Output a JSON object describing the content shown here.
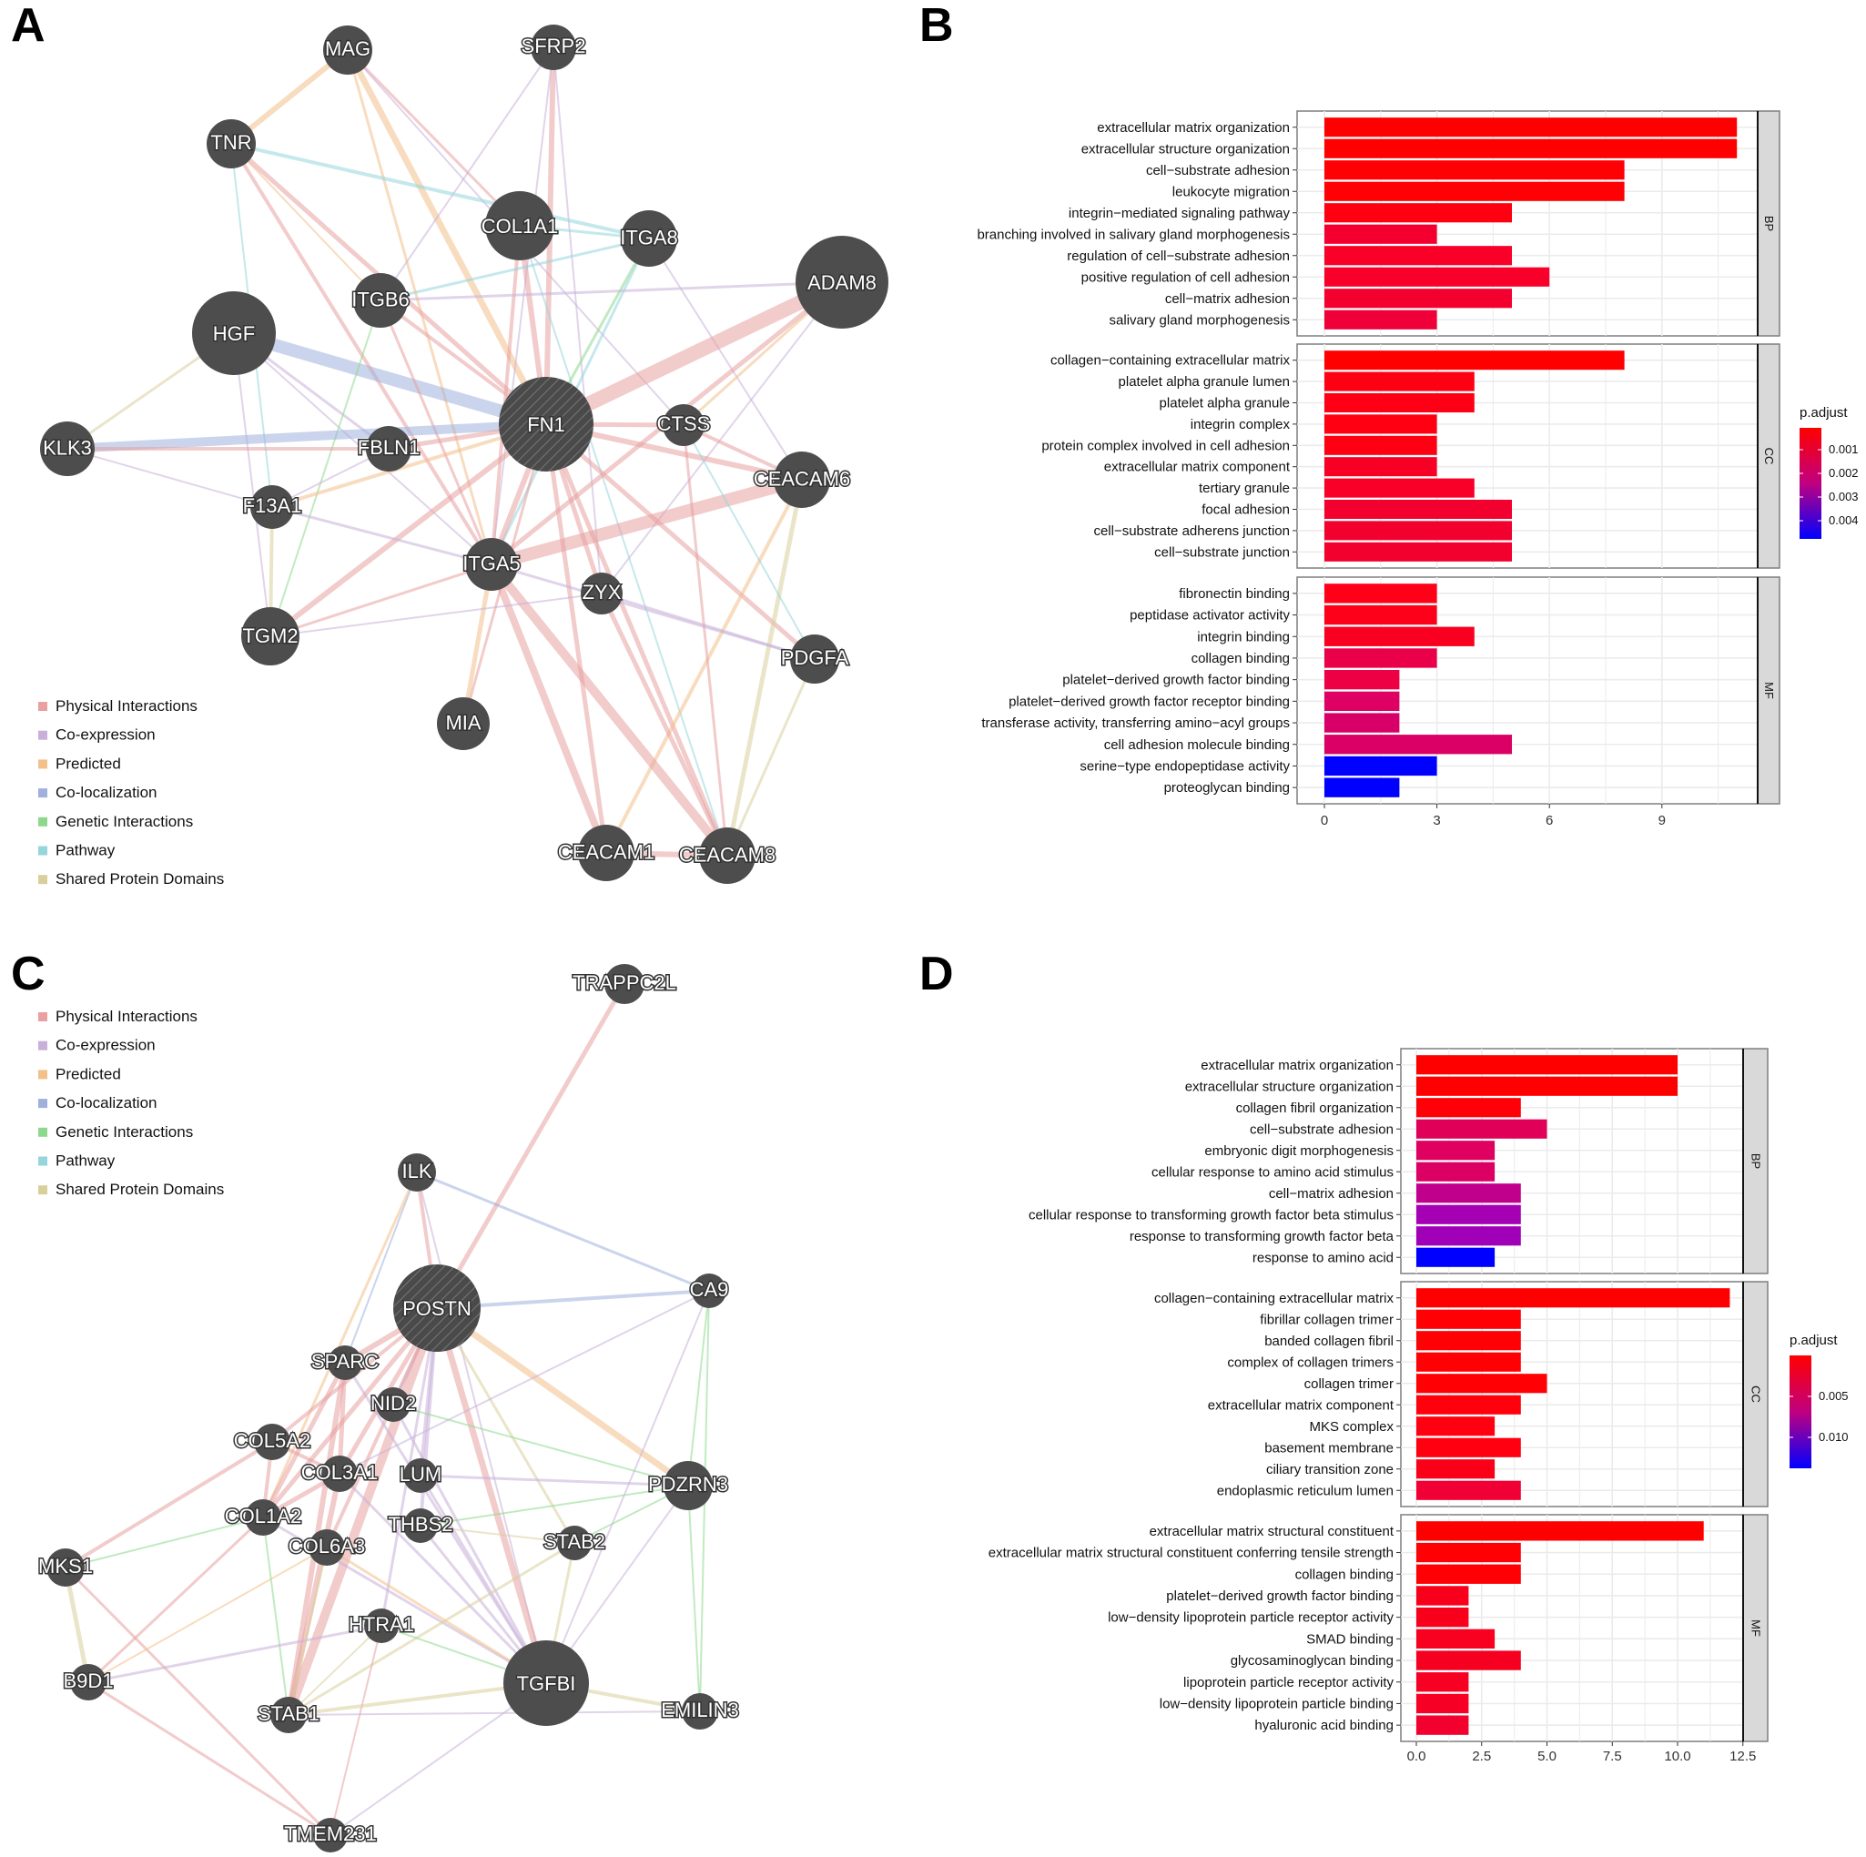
{
  "panels": {
    "A": "A",
    "B": "B",
    "C": "C",
    "D": "D"
  },
  "network_legend": [
    {
      "label": "Physical Interactions",
      "color": "#e8a0a0"
    },
    {
      "label": "Co-expression",
      "color": "#c9b0d8"
    },
    {
      "label": "Predicted",
      "color": "#f2c08a"
    },
    {
      "label": "Co-localization",
      "color": "#9fb0dc"
    },
    {
      "label": "Genetic Interactions",
      "color": "#8ed88e"
    },
    {
      "label": "Pathway",
      "color": "#95d6dc"
    },
    {
      "label": "Shared Protein Domains",
      "color": "#d8cf9c"
    }
  ],
  "network_A": {
    "query_gene": "FN1",
    "nodes": [
      {
        "id": "MAG"
      },
      {
        "id": "SFRP2"
      },
      {
        "id": "TNR"
      },
      {
        "id": "COL1A1"
      },
      {
        "id": "ITGA8"
      },
      {
        "id": "ADAM8"
      },
      {
        "id": "ITGB6"
      },
      {
        "id": "HGF"
      },
      {
        "id": "FN1"
      },
      {
        "id": "CTSS"
      },
      {
        "id": "KLK3"
      },
      {
        "id": "FBLN1"
      },
      {
        "id": "CEACAM6"
      },
      {
        "id": "F13A1"
      },
      {
        "id": "ITGA5"
      },
      {
        "id": "ZYX"
      },
      {
        "id": "TGM2"
      },
      {
        "id": "PDGFA"
      },
      {
        "id": "MIA"
      },
      {
        "id": "CEACAM1"
      },
      {
        "id": "CEACAM8"
      }
    ]
  },
  "network_C": {
    "query_gene": "POSTN",
    "nodes": [
      {
        "id": "TRAPPC2L"
      },
      {
        "id": "ILK"
      },
      {
        "id": "POSTN"
      },
      {
        "id": "CA9"
      },
      {
        "id": "SPARC"
      },
      {
        "id": "NID2"
      },
      {
        "id": "COL5A2"
      },
      {
        "id": "COL3A1"
      },
      {
        "id": "LUM"
      },
      {
        "id": "PDZRN3"
      },
      {
        "id": "COL1A2"
      },
      {
        "id": "THBS2"
      },
      {
        "id": "STAB2"
      },
      {
        "id": "MKS1"
      },
      {
        "id": "COL6A3"
      },
      {
        "id": "HTRA1"
      },
      {
        "id": "B9D1"
      },
      {
        "id": "TGFBI"
      },
      {
        "id": "STAB1"
      },
      {
        "id": "EMILIN3"
      },
      {
        "id": "TMEM231"
      }
    ]
  },
  "chart_data": [
    {
      "type": "bar",
      "orientation": "horizontal",
      "panel": "B",
      "xlabel": "",
      "ylabel": "",
      "xlim": [
        0,
        11.6
      ],
      "xticks": [
        "0",
        "3",
        "6",
        "9"
      ],
      "grid": true,
      "legend": {
        "title": "p.adjust",
        "position": "right",
        "ticks": [
          "0.001",
          "0.002",
          "0.003",
          "0.004"
        ],
        "low_color": "#ff0000",
        "high_color": "#0000ff"
      },
      "facets": [
        {
          "name": "BP",
          "bars": [
            {
              "label": "extracellular matrix organization",
              "value": 11,
              "color": "#ff0000"
            },
            {
              "label": "extracellular structure organization",
              "value": 11,
              "color": "#ff0000"
            },
            {
              "label": "cell−substrate adhesion",
              "value": 8,
              "color": "#ff0004"
            },
            {
              "label": "leukocyte migration",
              "value": 8,
              "color": "#ff0004"
            },
            {
              "label": "integrin−mediated signaling pathway",
              "value": 5,
              "color": "#fe0010"
            },
            {
              "label": "branching involved in salivary gland morphogenesis",
              "value": 3,
              "color": "#f40030"
            },
            {
              "label": "regulation of cell−substrate adhesion",
              "value": 5,
              "color": "#f80028"
            },
            {
              "label": "positive regulation of cell adhesion",
              "value": 6,
              "color": "#f8002a"
            },
            {
              "label": "cell−matrix adhesion",
              "value": 5,
              "color": "#f4002e"
            },
            {
              "label": "salivary gland morphogenesis",
              "value": 3,
              "color": "#f00038"
            }
          ]
        },
        {
          "name": "CC",
          "bars": [
            {
              "label": "collagen−containing extracellular matrix",
              "value": 8,
              "color": "#ff0000"
            },
            {
              "label": "platelet alpha granule lumen",
              "value": 4,
              "color": "#fd0014"
            },
            {
              "label": "platelet alpha granule",
              "value": 4,
              "color": "#fd0016"
            },
            {
              "label": "integrin complex",
              "value": 3,
              "color": "#fe0012"
            },
            {
              "label": "protein complex involved in cell adhesion",
              "value": 3,
              "color": "#fe0012"
            },
            {
              "label": "extracellular matrix component",
              "value": 3,
              "color": "#f80026"
            },
            {
              "label": "tertiary granule",
              "value": 4,
              "color": "#f80028"
            },
            {
              "label": "focal adhesion",
              "value": 5,
              "color": "#f2002e"
            },
            {
              "label": "cell−substrate adherens junction",
              "value": 5,
              "color": "#f2002e"
            },
            {
              "label": "cell−substrate junction",
              "value": 5,
              "color": "#f2002e"
            }
          ]
        },
        {
          "name": "MF",
          "bars": [
            {
              "label": "fibronectin binding",
              "value": 3,
              "color": "#fe0018"
            },
            {
              "label": "peptidase activator activity",
              "value": 3,
              "color": "#fd001a"
            },
            {
              "label": "integrin binding",
              "value": 4,
              "color": "#fa0020"
            },
            {
              "label": "collagen binding",
              "value": 3,
              "color": "#ea0048"
            },
            {
              "label": "platelet−derived growth factor binding",
              "value": 2,
              "color": "#ee0044"
            },
            {
              "label": "platelet−derived growth factor receptor binding",
              "value": 2,
              "color": "#de0062"
            },
            {
              "label": "transferase activity, transferring amino−acyl groups",
              "value": 2,
              "color": "#d80068"
            },
            {
              "label": "cell adhesion molecule binding",
              "value": 5,
              "color": "#da0066"
            },
            {
              "label": "serine−type endopeptidase activity",
              "value": 3,
              "color": "#0000ff"
            },
            {
              "label": "proteoglycan binding",
              "value": 2,
              "color": "#0000ff"
            }
          ]
        }
      ]
    },
    {
      "type": "bar",
      "orientation": "horizontal",
      "panel": "D",
      "xlabel": "",
      "ylabel": "",
      "xlim": [
        0,
        12.9
      ],
      "xticks": [
        "0.0",
        "2.5",
        "5.0",
        "7.5",
        "10.0",
        "12.5"
      ],
      "grid": true,
      "legend": {
        "title": "p.adjust",
        "position": "right",
        "ticks": [
          "0.005",
          "0.010"
        ],
        "low_color": "#ff0000",
        "high_color": "#0000ff"
      },
      "facets": [
        {
          "name": "BP",
          "bars": [
            {
              "label": "extracellular matrix organization",
              "value": 10,
              "color": "#ff0000"
            },
            {
              "label": "extracellular structure organization",
              "value": 10,
              "color": "#ff0000"
            },
            {
              "label": "collagen fibril organization",
              "value": 4,
              "color": "#ff0008"
            },
            {
              "label": "cell−substrate adhesion",
              "value": 5,
              "color": "#e00058"
            },
            {
              "label": "embryonic digit morphogenesis",
              "value": 3,
              "color": "#e00060"
            },
            {
              "label": "cellular response to amino acid stimulus",
              "value": 3,
              "color": "#dc0064"
            },
            {
              "label": "cell−matrix adhesion",
              "value": 4,
              "color": "#c0008c"
            },
            {
              "label": "cellular response to transforming growth factor beta stimulus",
              "value": 4,
              "color": "#a600b4"
            },
            {
              "label": "response to transforming growth factor beta",
              "value": 4,
              "color": "#a000b8"
            },
            {
              "label": "response to amino acid",
              "value": 3,
              "color": "#0000ff"
            }
          ]
        },
        {
          "name": "CC",
          "bars": [
            {
              "label": "collagen−containing extracellular matrix",
              "value": 12,
              "color": "#ff0000"
            },
            {
              "label": "fibrillar collagen trimer",
              "value": 4,
              "color": "#ff0004"
            },
            {
              "label": "banded collagen fibril",
              "value": 4,
              "color": "#ff0004"
            },
            {
              "label": "complex of collagen trimers",
              "value": 4,
              "color": "#ff0004"
            },
            {
              "label": "collagen trimer",
              "value": 5,
              "color": "#ff0004"
            },
            {
              "label": "extracellular matrix component",
              "value": 4,
              "color": "#ff000c"
            },
            {
              "label": "MKS complex",
              "value": 3,
              "color": "#ff0010"
            },
            {
              "label": "basement membrane",
              "value": 4,
              "color": "#ff0010"
            },
            {
              "label": "ciliary transition zone",
              "value": 3,
              "color": "#fa0018"
            },
            {
              "label": "endoplasmic reticulum lumen",
              "value": 4,
              "color": "#f00034"
            }
          ]
        },
        {
          "name": "MF",
          "bars": [
            {
              "label": "extracellular matrix structural constituent",
              "value": 11,
              "color": "#ff0000"
            },
            {
              "label": "extracellular matrix structural constituent conferring tensile strength",
              "value": 4,
              "color": "#ff0004"
            },
            {
              "label": "collagen binding",
              "value": 4,
              "color": "#ff0004"
            },
            {
              "label": "platelet−derived growth factor binding",
              "value": 2,
              "color": "#f8001c"
            },
            {
              "label": "low−density lipoprotein particle receptor activity",
              "value": 2,
              "color": "#f8001c"
            },
            {
              "label": "SMAD binding",
              "value": 3,
              "color": "#f80020"
            },
            {
              "label": "glycosaminoglycan binding",
              "value": 4,
              "color": "#f60022"
            },
            {
              "label": "lipoprotein particle receptor activity",
              "value": 2,
              "color": "#f60024"
            },
            {
              "label": "low−density lipoprotein particle binding",
              "value": 2,
              "color": "#f60026"
            },
            {
              "label": "hyaluronic acid binding",
              "value": 2,
              "color": "#f2002e"
            }
          ]
        }
      ]
    }
  ]
}
